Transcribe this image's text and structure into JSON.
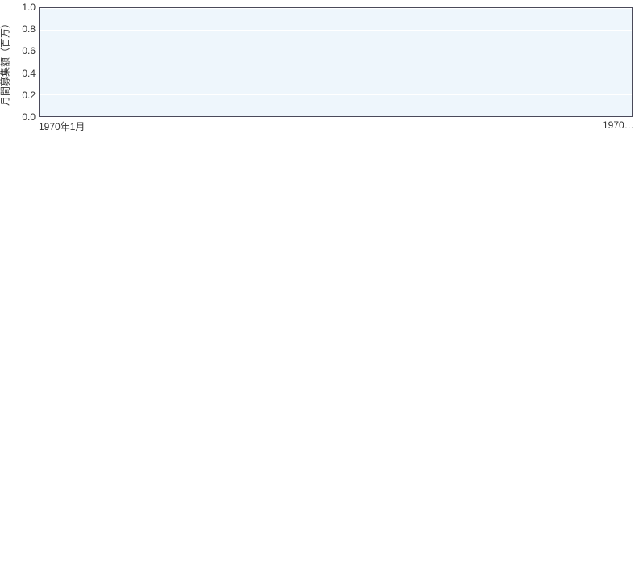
{
  "chart_data": {
    "type": "bar",
    "categories": [
      "1970年1月",
      "1970…"
    ],
    "values": [
      0,
      0
    ],
    "title": "",
    "xlabel": "",
    "ylabel": "月間募集額（百万）",
    "ylim": [
      0.0,
      1.0
    ],
    "y_ticks": [
      0.0,
      0.2,
      0.4,
      0.6,
      0.8,
      1.0
    ],
    "y_tick_labels": [
      "0.0",
      "0.2",
      "0.4",
      "0.6",
      "0.8",
      "1.0"
    ],
    "x_tick_labels": [
      "1970年1月",
      "1970…"
    ]
  }
}
